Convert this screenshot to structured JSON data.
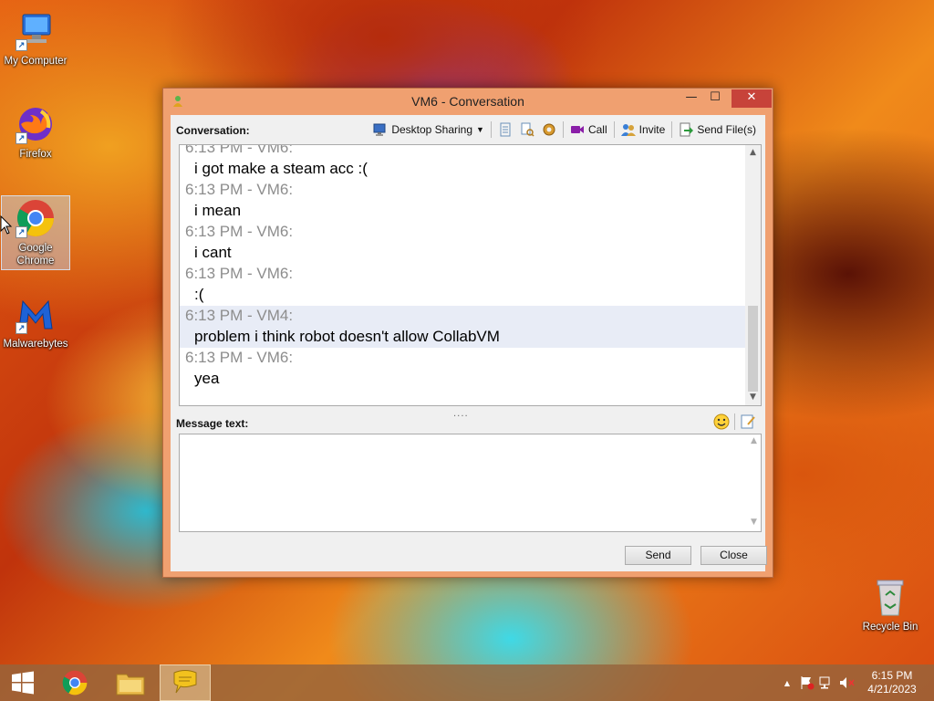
{
  "desktop": {
    "icons": [
      {
        "label": "My Computer"
      },
      {
        "label": "Firefox"
      },
      {
        "label": "Google Chrome"
      },
      {
        "label": "Malwarebytes"
      },
      {
        "label": "Recycle Bin"
      }
    ]
  },
  "window": {
    "title": "VM6 - Conversation",
    "conversation_label": "Conversation:",
    "toolbar": {
      "desktop_sharing": "Desktop Sharing",
      "call": "Call",
      "invite": "Invite",
      "send_files": "Send File(s)"
    },
    "history": [
      {
        "meta": "6:13 PM - VM6:",
        "text": "i got make a steam acc :(",
        "highlighted": false
      },
      {
        "meta": "6:13 PM - VM6:",
        "text": "i mean",
        "highlighted": false
      },
      {
        "meta": "6:13 PM - VM6:",
        "text": "i cant",
        "highlighted": false
      },
      {
        "meta": "6:13 PM - VM6:",
        "text": ":(",
        "highlighted": false
      },
      {
        "meta": "6:13 PM - VM4:",
        "text": "problem i think robot doesn't allow CollabVM",
        "highlighted": true
      },
      {
        "meta": "6:13 PM - VM6:",
        "text": "yea",
        "highlighted": false
      }
    ],
    "splitter": "....",
    "message_label": "Message text:",
    "message_value": "",
    "send_button": "Send",
    "close_button": "Close",
    "minimize_glyph": "—",
    "maximize_glyph": "☐",
    "close_glyph": "✕"
  },
  "taskbar": {
    "clock_time": "6:15 PM",
    "clock_date": "4/21/2023",
    "tray_up_glyph": "▲"
  },
  "colors": {
    "window_frame": "#f0a070",
    "close_button": "#c7433a",
    "highlight_row": "#e8ecf6",
    "meta_text": "#8d8d8d"
  }
}
